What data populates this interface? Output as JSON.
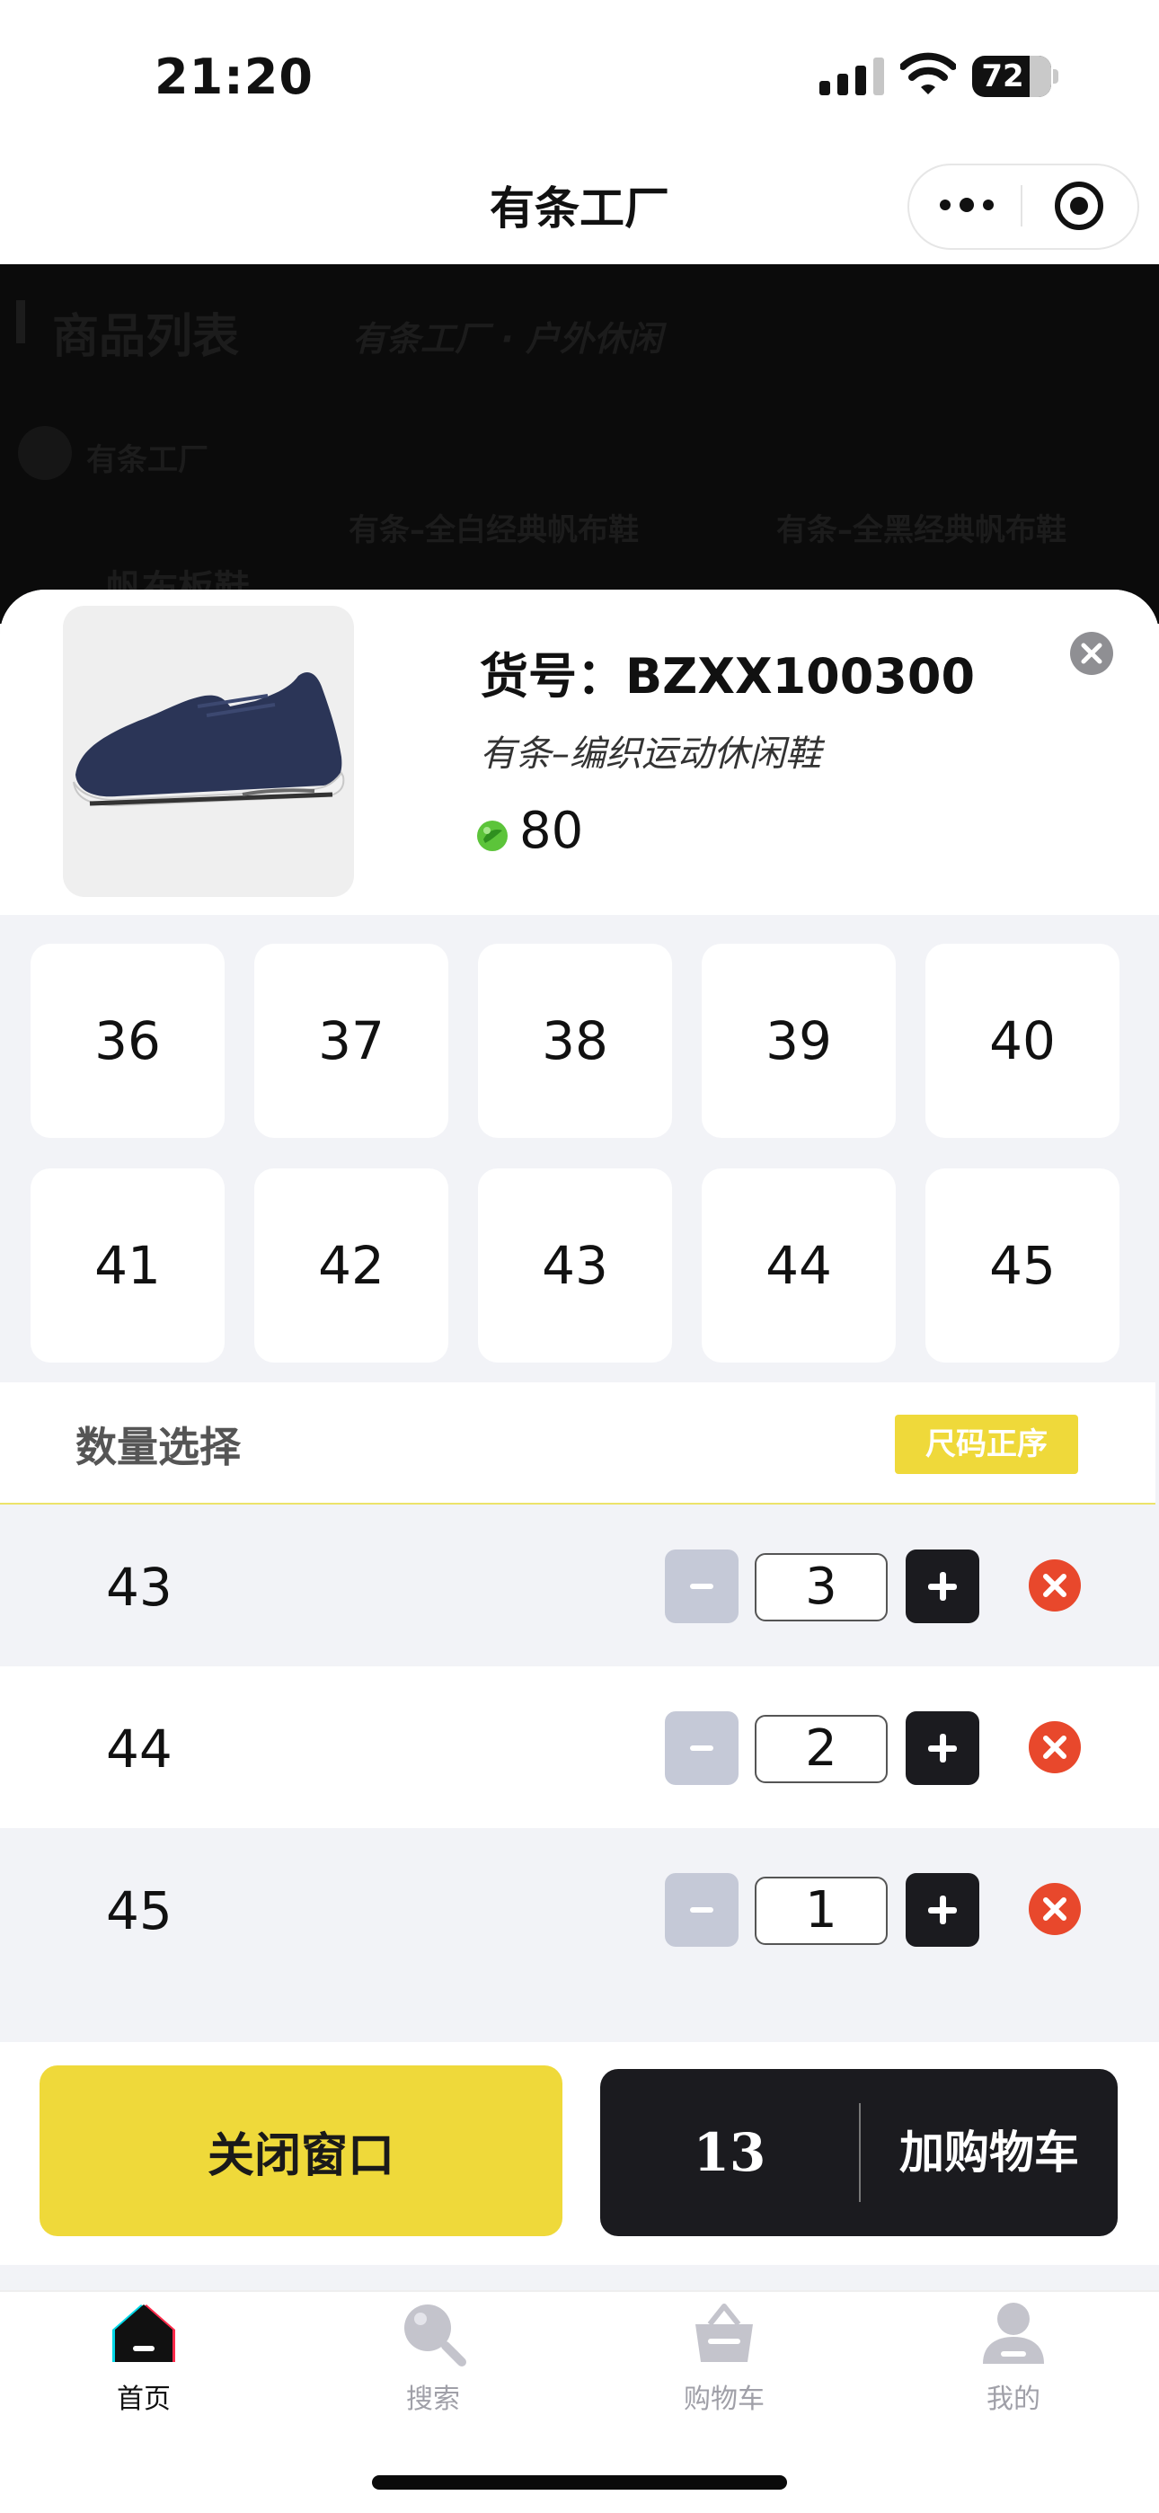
{
  "status_bar": {
    "time": "21:20",
    "battery": "72"
  },
  "nav": {
    "title": "有条工厂"
  },
  "background_page": {
    "section_title": "商品列表",
    "breadcrumb": "有条工厂 · 户外休闲",
    "shop_name": "有条工厂",
    "item_1": "有条–全白经典帆布鞋",
    "item_2": "有条–全黑经典帆布鞋",
    "category": "帆布板鞋"
  },
  "product": {
    "code": "货号：BZXX100300",
    "name": "有条–编织运动休闲鞋",
    "price": "80"
  },
  "sizes": [
    "36",
    "37",
    "38",
    "39",
    "40",
    "41",
    "42",
    "43",
    "44",
    "45"
  ],
  "quantity": {
    "title": "数量选择",
    "sort_label": "尺码正序",
    "rows": [
      {
        "size": "43",
        "qty": "3"
      },
      {
        "size": "44",
        "qty": "2"
      },
      {
        "size": "45",
        "qty": "1"
      }
    ]
  },
  "footer": {
    "close_label": "关闭窗口",
    "total": "13",
    "add_cart_label": "加购物车"
  },
  "tabs": [
    {
      "label": "首页",
      "icon": "home-icon",
      "active": true
    },
    {
      "label": "搜索",
      "icon": "search-icon",
      "active": false
    },
    {
      "label": "购物车",
      "icon": "basket-icon",
      "active": false
    },
    {
      "label": "我的",
      "icon": "user-icon",
      "active": false
    }
  ],
  "colors": {
    "accent_yellow": "#efd93a",
    "dark": "#1b1b1f",
    "remove_red": "#e8482c",
    "coin_green": "#5cc43a"
  }
}
